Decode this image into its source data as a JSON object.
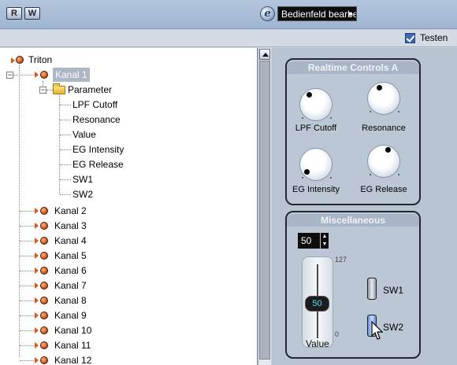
{
  "toolbar": {
    "r_button": "R",
    "w_button": "W",
    "edit_icon_glyph": "e",
    "dropdown_value": "Bedienfeld bearbei"
  },
  "testen": {
    "label": "Testen",
    "checked": true
  },
  "tree": {
    "root": "Triton",
    "selected": "Kanal 1",
    "parameter": "Parameter",
    "params": [
      "LPF Cutoff",
      "Resonance",
      "Value",
      "EG Intensity",
      "EG Release",
      "SW1",
      "SW2"
    ],
    "channels": [
      "Kanal 2",
      "Kanal 3",
      "Kanal 4",
      "Kanal 5",
      "Kanal 6",
      "Kanal 7",
      "Kanal 8",
      "Kanal 9",
      "Kanal 10",
      "Kanal 11",
      "Kanal 12"
    ]
  },
  "realtime": {
    "title": "Realtime Controls A",
    "knobs": [
      "LPF Cutoff",
      "Resonance",
      "EG Intensity",
      "EG Release"
    ]
  },
  "misc": {
    "title": "Miscellaneous",
    "spin_value": "50",
    "fader_value": "50",
    "fader_max": "127",
    "fader_min": "0",
    "fader_label": "Value",
    "sw1": "SW1",
    "sw2": "SW2"
  },
  "colors": {
    "toolbar": "#a9bdd7",
    "accent_checkbox": "#3d67b8",
    "channel_icon": "#d35a1c",
    "fader_value_text": "#4fe0f0"
  }
}
